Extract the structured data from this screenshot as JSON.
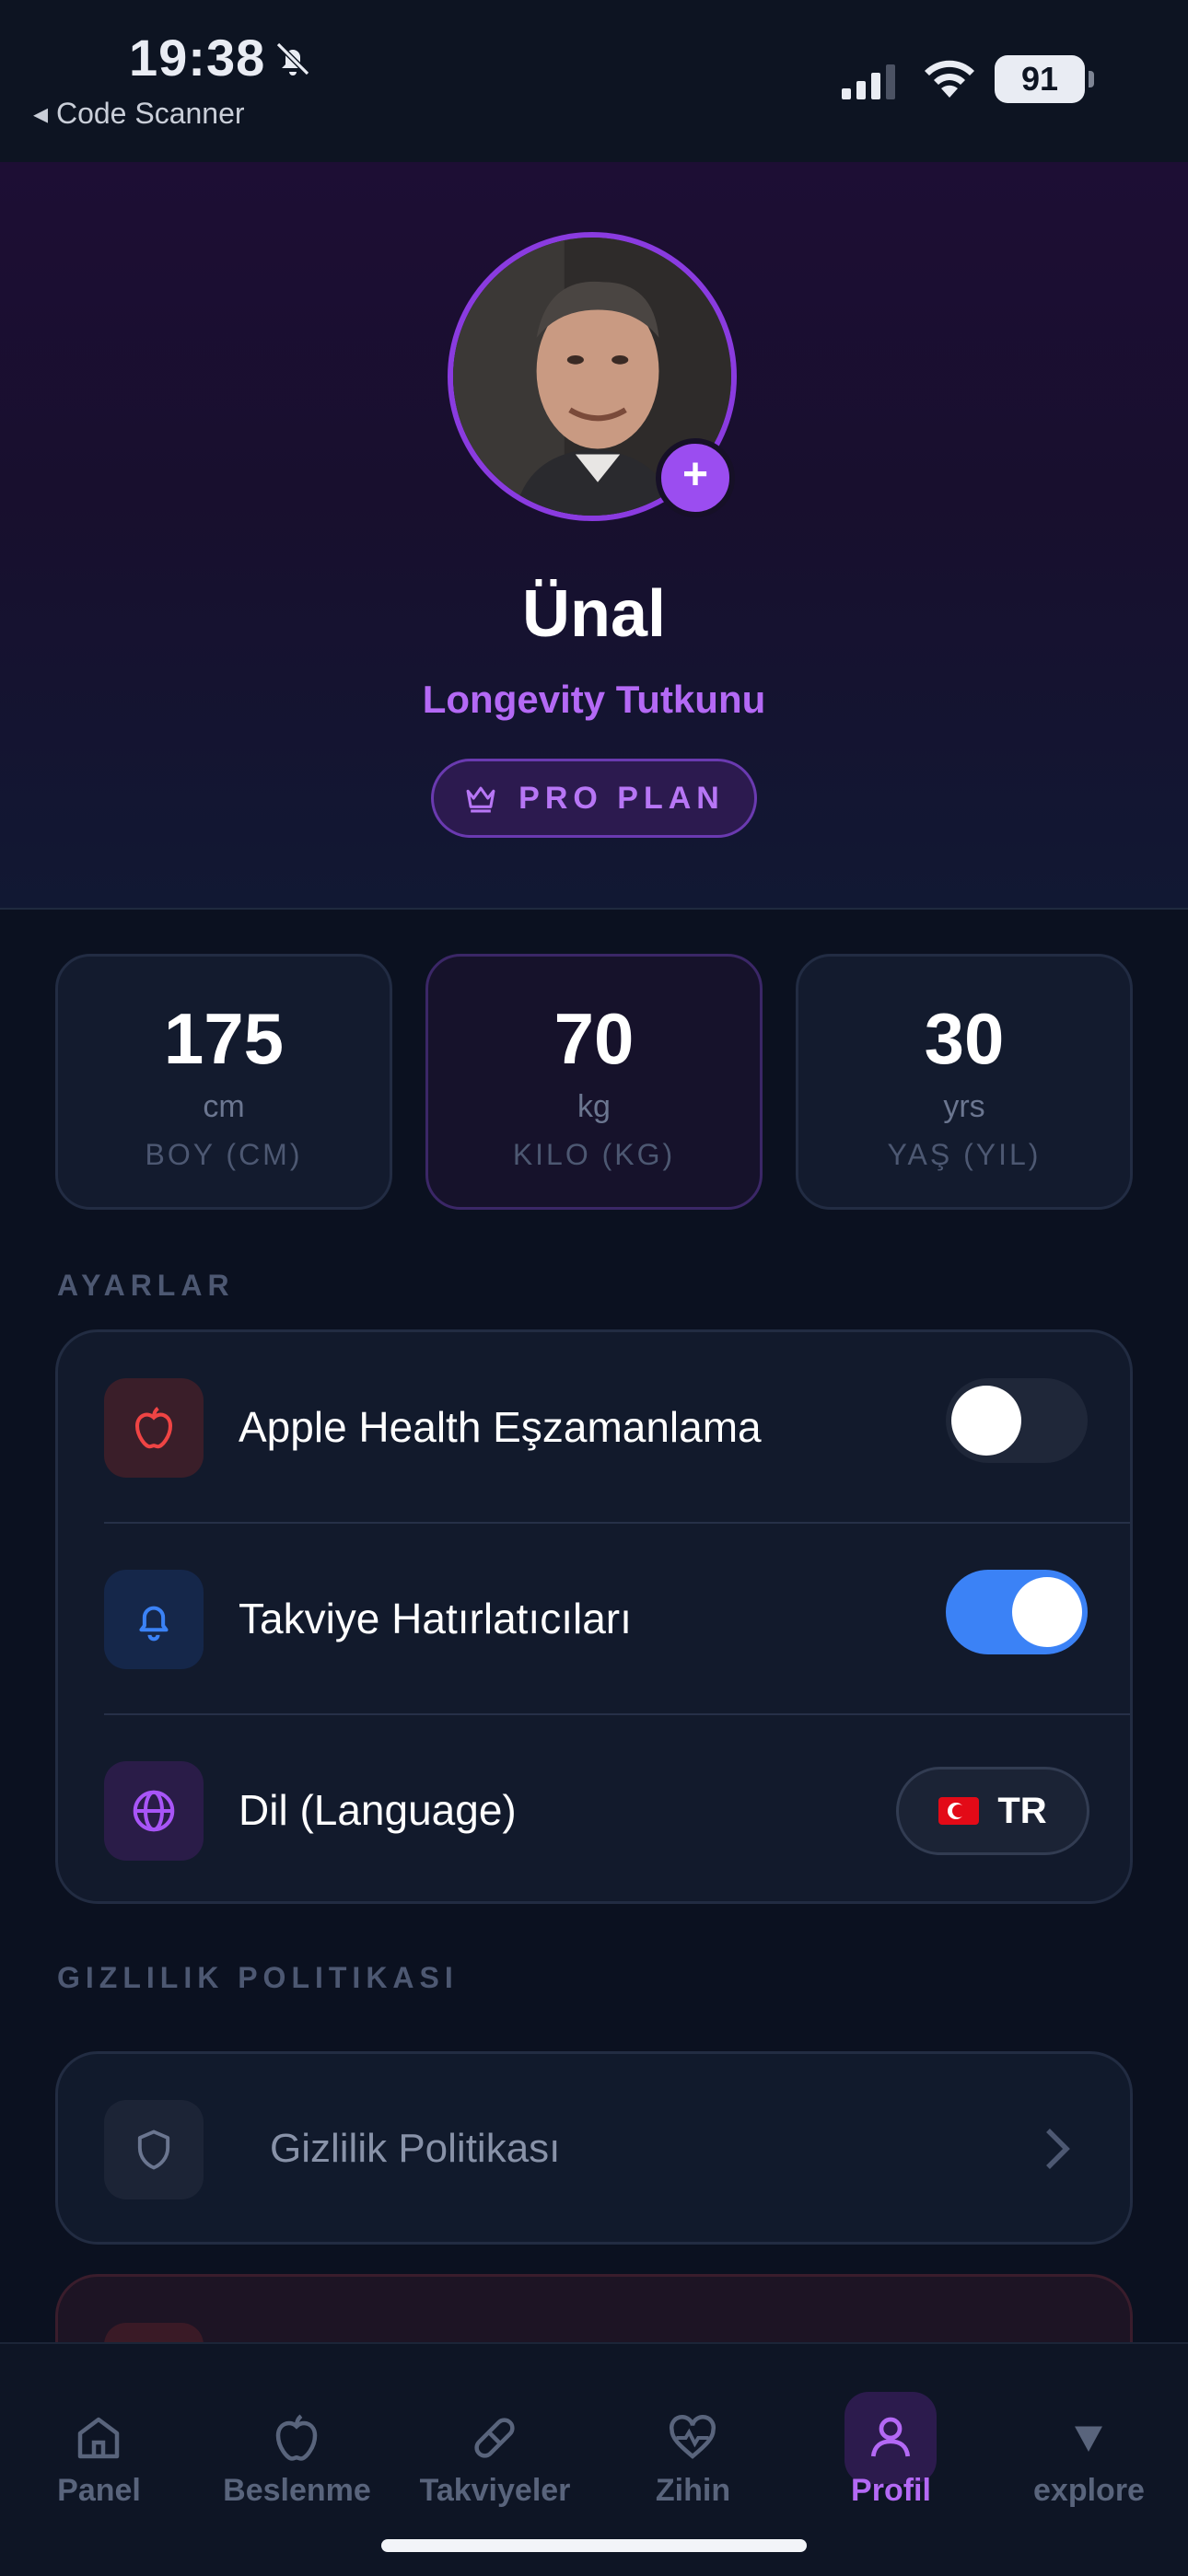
{
  "status_bar": {
    "time": "19:38",
    "back_label": "◂ Code Scanner",
    "battery": "91"
  },
  "profile": {
    "name": "Ünal",
    "subtitle": "Longevity Tutkunu",
    "plan_badge": "PRO PLAN",
    "add_photo_symbol": "+"
  },
  "stats": [
    {
      "value": "175",
      "unit": "cm",
      "label": "BOY (CM)"
    },
    {
      "value": "70",
      "unit": "kg",
      "label": "KILO (KG)"
    },
    {
      "value": "30",
      "unit": "yrs",
      "label": "YAŞ (YIL)"
    }
  ],
  "settings": {
    "section_title": "AYARLAR",
    "items": [
      {
        "label": "Apple Health Eşzamanlama",
        "icon": "apple-icon",
        "toggle_on": false
      },
      {
        "label": "Takviye Hatırlatıcıları",
        "icon": "bell-icon",
        "toggle_on": true
      },
      {
        "label": "Dil (Language)",
        "icon": "globe-icon",
        "value": "TR"
      }
    ]
  },
  "privacy": {
    "section_title": "GIZLILIK POLITIKASI",
    "item_label": "Gizlilik Politikası"
  },
  "tabs": [
    {
      "label": "Panel",
      "icon": "home-icon"
    },
    {
      "label": "Beslenme",
      "icon": "apple-icon"
    },
    {
      "label": "Takviyeler",
      "icon": "pill-icon"
    },
    {
      "label": "Zihin",
      "icon": "heart-pulse-icon"
    },
    {
      "label": "Profil",
      "icon": "user-icon",
      "active": true
    },
    {
      "label": "explore",
      "icon": "triangle-down-icon"
    }
  ],
  "colors": {
    "accent_purple": "#b469f5",
    "toggle_on": "#3b82f6",
    "background": "#0b1120"
  }
}
